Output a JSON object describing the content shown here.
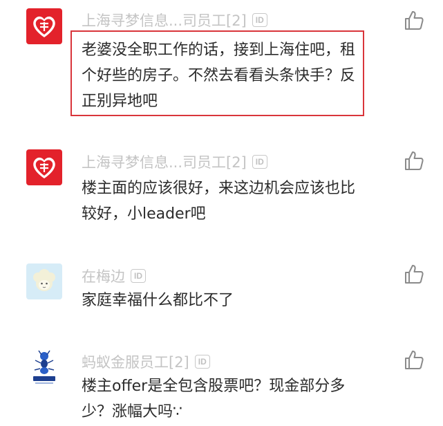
{
  "id_badge": "ID",
  "comments": [
    {
      "avatar": "pinduoduo-logo",
      "username": "上海寻梦信息...司员工[2]",
      "text": "老婆没全职工作的话，接到上海住吧，租个好些的房子。不然去看看头条快手？反正别异地吧",
      "highlighted": true
    },
    {
      "avatar": "pinduoduo-logo",
      "username": "上海寻梦信息...司员工[2]",
      "text": "楼主面的应该很好，来这边机会应该也比较好，小leader吧",
      "highlighted": false
    },
    {
      "avatar": "sheep-avatar",
      "username": "在梅边",
      "text": "家庭幸福什么都比不了",
      "highlighted": false
    },
    {
      "avatar": "ant-group-logo",
      "username": "蚂蚁金服员工[2]",
      "text": "楼主offer是全包含股票吧？现金部分多少？涨幅大吗∵",
      "highlighted": false
    }
  ],
  "colors": {
    "pinduoduo_red": "#e3222b",
    "highlight_border": "#d9343a",
    "username_gray": "#c4c4c4",
    "text_dark": "#2b2b2b",
    "sheep_bg": "#d6ecf7"
  }
}
